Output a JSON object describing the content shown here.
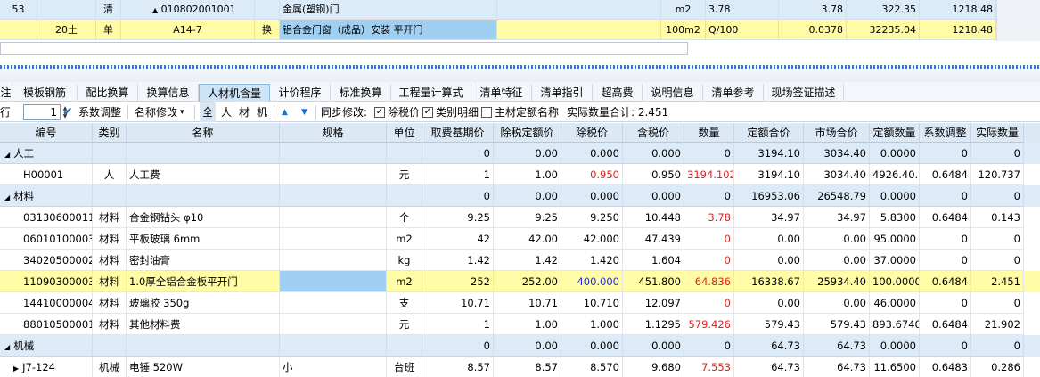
{
  "upper": {
    "rows": [
      {
        "seq": "53",
        "blank": "",
        "type": "清",
        "code": "010802001001",
        "code_prefix": "▲",
        "swap": "",
        "name": "金属(塑钢)门",
        "feature": "",
        "unit": "m2",
        "qty_expr": "3.78",
        "qty": "3.78",
        "price": "322.35",
        "total": "1218.48"
      },
      {
        "seq": "",
        "blank": "20土",
        "type": "单",
        "code": "A14-7",
        "code_prefix": "",
        "swap": "换",
        "name": "铝合金门窗（成品）安装 平开门",
        "feature": "",
        "unit": "100m2",
        "qty_expr": "Q/100",
        "qty": "0.0378",
        "price": "32235.04",
        "total": "1218.48"
      }
    ]
  },
  "tabs": [
    {
      "label": "注"
    },
    {
      "label": "模板钢筋"
    },
    {
      "label": "配比换算"
    },
    {
      "label": "换算信息"
    },
    {
      "label": "人材机含量"
    },
    {
      "label": "计价程序"
    },
    {
      "label": "标准换算"
    },
    {
      "label": "工程量计算式"
    },
    {
      "label": "清单特征"
    },
    {
      "label": "清单指引"
    },
    {
      "label": "超高费"
    },
    {
      "label": "说明信息"
    },
    {
      "label": "清单参考"
    },
    {
      "label": "现场签证描述"
    }
  ],
  "active_tab": 4,
  "toolbar": {
    "row_label": "行",
    "row_value": "1",
    "coef_adjust": "系数调整",
    "name_edit": "名称修改",
    "filter_all": "全",
    "filter_labor": "人",
    "filter_material": "材",
    "filter_machine": "机",
    "sync_edit": "同步修改:",
    "excl_tax_price": "除税价",
    "category_detail": "类别明细",
    "main_quota_name": "主材定额名称",
    "actual_qty_total": "实际数量合计: 2.451",
    "up_arrow": "▲",
    "down_arrow": "▼"
  },
  "grid": {
    "headers": [
      "编号",
      "类别",
      "名称",
      "规格",
      "单位",
      "取费基期价",
      "除税定额价",
      "除税价",
      "含税价",
      "数量",
      "定额合价",
      "市场合价",
      "定额数量",
      "系数调整",
      "实际数量"
    ],
    "rows": [
      {
        "kind": "group",
        "expander": "◢",
        "cells": [
          "人工",
          "",
          "",
          "",
          "",
          "0",
          "0.00",
          "0.000",
          "0.000",
          "0",
          "3194.10",
          "3034.40",
          "0.0000",
          "0",
          "0"
        ]
      },
      {
        "kind": "item",
        "cells": [
          "H00001",
          "人",
          "人工费",
          "",
          "元",
          "1",
          "1.00",
          "0.950",
          "0.950",
          "3194.102",
          "3194.10",
          "3034.40",
          "4926.40...",
          "0.6484",
          "120.737"
        ],
        "red": [
          7,
          9
        ]
      },
      {
        "kind": "group",
        "expander": "◢",
        "cells": [
          "材料",
          "",
          "",
          "",
          "",
          "0",
          "0.00",
          "0.000",
          "0.000",
          "0",
          "16953.06",
          "26548.79",
          "0.0000",
          "0",
          "0"
        ]
      },
      {
        "kind": "item",
        "cells": [
          "03130600011",
          "材料",
          "合金钢钻头 φ10",
          "",
          "个",
          "9.25",
          "9.25",
          "9.250",
          "10.448",
          "3.78",
          "34.97",
          "34.97",
          "5.8300",
          "0.6484",
          "0.143"
        ],
        "red": [
          9
        ]
      },
      {
        "kind": "item",
        "cells": [
          "06010100003",
          "材料",
          "平板玻璃 6mm",
          "",
          "m2",
          "42",
          "42.00",
          "42.000",
          "47.439",
          "0",
          "0.00",
          "0.00",
          "95.0000",
          "0",
          "0"
        ],
        "red": [
          9
        ]
      },
      {
        "kind": "item",
        "cells": [
          "34020500002",
          "材料",
          "密封油膏",
          "",
          "kg",
          "1.42",
          "1.42",
          "1.420",
          "1.604",
          "0",
          "0.00",
          "0.00",
          "37.0000",
          "0",
          "0"
        ],
        "red": [
          9
        ]
      },
      {
        "kind": "highlight",
        "cells": [
          "11090300003~",
          "材料",
          "1.0厚全铝合金板平开门",
          "",
          "m2",
          "252",
          "252.00",
          "400.000",
          "451.800",
          "64.836",
          "16338.67",
          "25934.40",
          "100.0000",
          "0.6484",
          "2.451"
        ],
        "red": [
          9
        ],
        "blue": [
          7
        ]
      },
      {
        "kind": "item",
        "cells": [
          "14410000004",
          "材料",
          "玻璃胶 350g",
          "",
          "支",
          "10.71",
          "10.71",
          "10.710",
          "12.097",
          "0",
          "0.00",
          "0.00",
          "46.0000",
          "0",
          "0"
        ],
        "red": [
          9
        ]
      },
      {
        "kind": "item",
        "cells": [
          "88010500001",
          "材料",
          "其他材料费",
          "",
          "元",
          "1",
          "1.00",
          "1.000",
          "1.1295",
          "579.426",
          "579.43",
          "579.43",
          "893.6740",
          "0.6484",
          "21.902"
        ],
        "red": [
          9
        ]
      },
      {
        "kind": "group",
        "expander": "◢",
        "cells": [
          "机械",
          "",
          "",
          "",
          "",
          "0",
          "0.00",
          "0.000",
          "0.000",
          "0",
          "64.73",
          "64.73",
          "0.0000",
          "0",
          "0"
        ]
      },
      {
        "kind": "item",
        "expander": "▶",
        "cells": [
          "J7-124",
          "机械",
          "电锤 520W",
          "小",
          "台班",
          "8.57",
          "8.57",
          "8.570",
          "9.680",
          "7.553",
          "64.73",
          "64.73",
          "11.6500",
          "0.6483",
          "0.286"
        ],
        "red": [
          9
        ]
      }
    ]
  }
}
